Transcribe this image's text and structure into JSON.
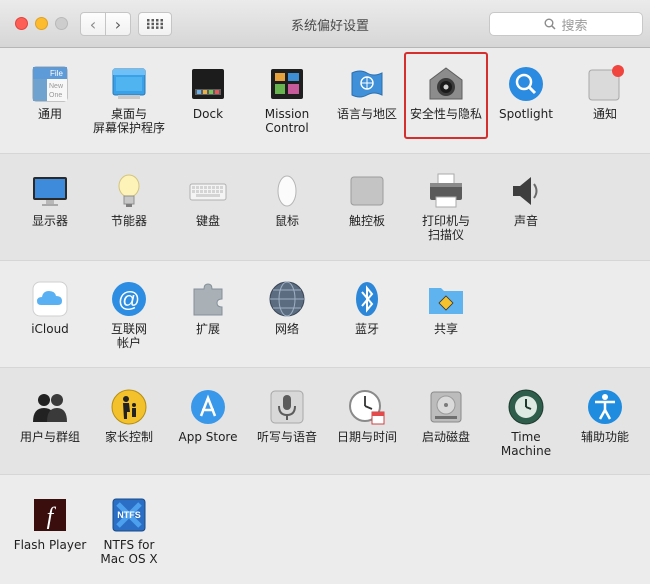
{
  "window": {
    "title": "系统偏好设置"
  },
  "search": {
    "placeholder": "搜索"
  },
  "rows": [
    [
      {
        "label": "通用",
        "icon": "general-icon"
      },
      {
        "label": "桌面与\n屏幕保护程序",
        "icon": "desktop-icon"
      },
      {
        "label": "Dock",
        "icon": "dock-icon"
      },
      {
        "label": "Mission\nControl",
        "icon": "mission-control-icon"
      },
      {
        "label": "语言与地区",
        "icon": "language-region-icon"
      },
      {
        "label": "安全性与隐私",
        "icon": "security-privacy-icon"
      },
      {
        "label": "Spotlight",
        "icon": "spotlight-icon"
      },
      {
        "label": "通知",
        "icon": "notifications-icon"
      }
    ],
    [
      {
        "label": "显示器",
        "icon": "display-icon"
      },
      {
        "label": "节能器",
        "icon": "energy-saver-icon"
      },
      {
        "label": "键盘",
        "icon": "keyboard-icon"
      },
      {
        "label": "鼠标",
        "icon": "mouse-icon"
      },
      {
        "label": "触控板",
        "icon": "trackpad-icon"
      },
      {
        "label": "打印机与\n扫描仪",
        "icon": "printer-icon"
      },
      {
        "label": "声音",
        "icon": "sound-icon"
      }
    ],
    [
      {
        "label": "iCloud",
        "icon": "icloud-icon"
      },
      {
        "label": "互联网\n帐户",
        "icon": "internet-accounts-icon"
      },
      {
        "label": "扩展",
        "icon": "extensions-icon"
      },
      {
        "label": "网络",
        "icon": "network-icon"
      },
      {
        "label": "蓝牙",
        "icon": "bluetooth-icon"
      },
      {
        "label": "共享",
        "icon": "sharing-icon"
      }
    ],
    [
      {
        "label": "用户与群组",
        "icon": "users-groups-icon"
      },
      {
        "label": "家长控制",
        "icon": "parental-controls-icon"
      },
      {
        "label": "App Store",
        "icon": "app-store-icon"
      },
      {
        "label": "听写与语音",
        "icon": "dictation-icon"
      },
      {
        "label": "日期与时间",
        "icon": "date-time-icon"
      },
      {
        "label": "启动磁盘",
        "icon": "startup-disk-icon"
      },
      {
        "label": "Time Machine",
        "icon": "time-machine-icon"
      },
      {
        "label": "辅助功能",
        "icon": "accessibility-icon"
      }
    ],
    [
      {
        "label": "Flash Player",
        "icon": "flash-player-icon"
      },
      {
        "label": "NTFS for\nMac OS X",
        "icon": "ntfs-icon"
      }
    ]
  ],
  "general_icon_text": [
    "File",
    "New",
    "One"
  ]
}
